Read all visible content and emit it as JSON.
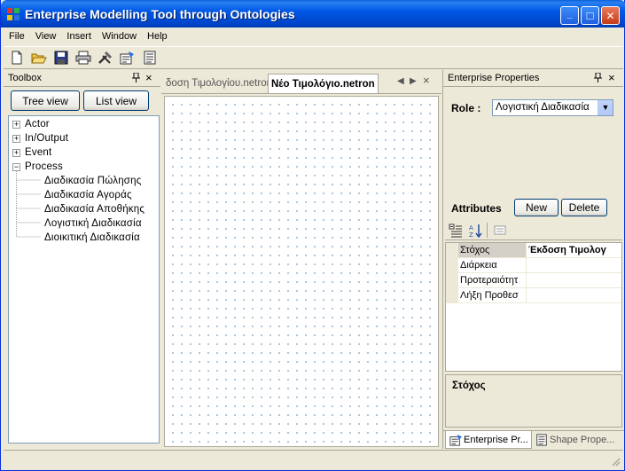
{
  "window": {
    "title": "Enterprise Modelling Tool through Ontologies",
    "min_glyph": "_",
    "max_glyph": "□",
    "close_glyph": "✕"
  },
  "menu": [
    "File",
    "View",
    "Insert",
    "Window",
    "Help"
  ],
  "toolbar": {
    "icons": [
      "new-file-icon",
      "open-folder-icon",
      "save-icon",
      "print-icon",
      "tools-icon",
      "properties-icon",
      "document-list-icon"
    ]
  },
  "toolbox": {
    "title": "Toolbox",
    "pin": "↕",
    "close": "×",
    "tree_view_label": "Tree view",
    "list_view_label": "List view",
    "nodes": [
      {
        "label": "Actor",
        "expander": "+"
      },
      {
        "label": "In/Output",
        "expander": "+"
      },
      {
        "label": "Event",
        "expander": "+"
      },
      {
        "label": "Process",
        "expander": "−"
      }
    ],
    "process_children": [
      "Διαδικασία Πώλησης",
      "Διαδικασία Αγοράς",
      "Διαδικασία Αποθήκης",
      "Λογιστική Διαδικασία",
      "Διοικιτική Διαδικασία"
    ]
  },
  "documents": {
    "tabs": [
      "δοση Τιμολογίου.netron",
      "Νέο Τιμολόγιο.netron"
    ],
    "active_tab": 1,
    "nav_left": "◀",
    "nav_right": "▶",
    "close": "×"
  },
  "properties": {
    "title": "Enterprise Properties",
    "pin": "↕",
    "close": "×",
    "role_label": "Role :",
    "role_value": "Λογιστική Διαδικασία",
    "attributes_label": "Attributes",
    "new_label": "New",
    "delete_label": "Delete",
    "grid": [
      {
        "name": "Στόχος",
        "value": "Έκδοση Τιμολογ",
        "selected": true
      },
      {
        "name": "Διάρκεια",
        "value": ""
      },
      {
        "name": "Προτεραιότητ",
        "value": ""
      },
      {
        "name": "Λήξη Προθεσ",
        "value": ""
      }
    ],
    "description_title": "Στόχος",
    "bottom_tabs": [
      "Enterprise Pr...",
      "Shape Prope..."
    ]
  },
  "colors": {
    "title_bar": "#0058e6",
    "window_bg": "#ece9d8",
    "canvas_dot": "#7aa0c0"
  }
}
